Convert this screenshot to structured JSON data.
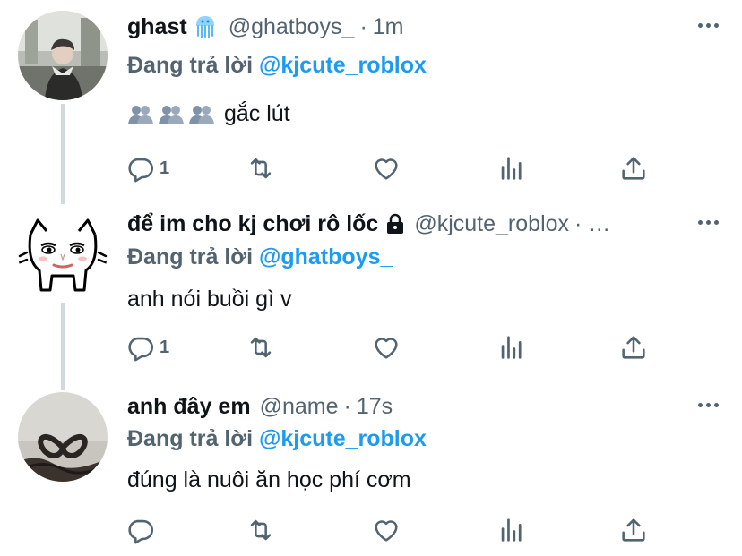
{
  "tweets": [
    {
      "name": "ghast",
      "name_emoji": "jellyfish-icon",
      "handle": "@ghatboys_",
      "sep": "·",
      "time": "1m",
      "replying_prefix": "Đang trả lời",
      "replying_to": "@kjcute_roblox",
      "text": "gắc lút",
      "text_emoji": "three-people-silhouette-icons",
      "reply_count": "1"
    },
    {
      "name": "để im cho kj chơi rô lốc",
      "name_emoji": "lock-icon",
      "handle": "@kjcute_roblox",
      "sep": "· …",
      "time": "",
      "replying_prefix": "Đang trả lời",
      "replying_to": "@ghatboys_",
      "text": "anh nói buồi gì v",
      "reply_count": "1"
    },
    {
      "name": "anh đây em",
      "handle": "@name",
      "sep": "·",
      "time": "17s",
      "replying_prefix": "Đang trả lời",
      "replying_to": "@kjcute_roblox",
      "text": "đúng là nuôi ăn học phí cơm",
      "reply_count": ""
    }
  ],
  "colors": {
    "accent": "#1d9bf0",
    "secondary_text": "#536471",
    "primary_text": "#0f1419",
    "thread_line": "#cfd9de"
  }
}
